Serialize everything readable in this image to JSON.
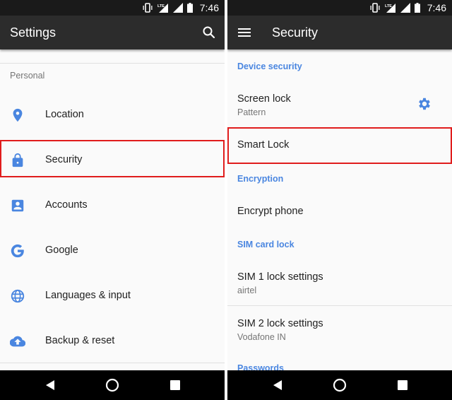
{
  "status_bar": {
    "time": "7:46",
    "icons": [
      "vibrate-icon",
      "lte-signal-icon",
      "signal-icon",
      "battery-icon"
    ]
  },
  "left_screen": {
    "title": "Settings",
    "section_label": "Personal",
    "items": [
      {
        "label": "Location",
        "icon": "location-pin-icon"
      },
      {
        "label": "Security",
        "icon": "lock-icon",
        "highlighted": true
      },
      {
        "label": "Accounts",
        "icon": "account-box-icon"
      },
      {
        "label": "Google",
        "icon": "google-g-icon"
      },
      {
        "label": "Languages & input",
        "icon": "globe-icon"
      },
      {
        "label": "Backup & reset",
        "icon": "cloud-upload-icon"
      }
    ]
  },
  "right_screen": {
    "title": "Security",
    "sections": {
      "device_security": "Device security",
      "encryption": "Encryption",
      "sim_card_lock": "SIM card lock",
      "passwords": "Passwords"
    },
    "items": {
      "screen_lock": {
        "title": "Screen lock",
        "subtitle": "Pattern"
      },
      "smart_lock": {
        "title": "Smart Lock",
        "highlighted": true
      },
      "encrypt_phone": {
        "title": "Encrypt phone"
      },
      "sim1": {
        "title": "SIM 1 lock settings",
        "subtitle": "airtel"
      },
      "sim2": {
        "title": "SIM 2 lock settings",
        "subtitle": "Vodafone IN"
      }
    }
  },
  "colors": {
    "accent": "#4a86e0",
    "highlight_border": "#e01c1c",
    "app_bar": "#2c2c2c",
    "status_bar": "#1a1a1a"
  }
}
